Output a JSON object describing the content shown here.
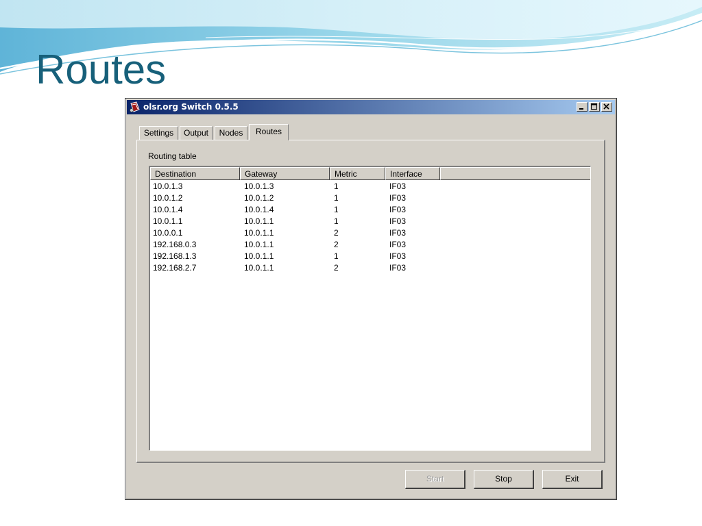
{
  "slide": {
    "title": "Routes"
  },
  "window": {
    "title": "olsr.org Switch 0.5.5",
    "controls": {
      "minimize_icon": "minimize-icon",
      "maximize_icon": "maximize-icon",
      "close_icon": "close-icon"
    }
  },
  "tabs": [
    {
      "label": "Settings",
      "active": false
    },
    {
      "label": "Output",
      "active": false
    },
    {
      "label": "Nodes",
      "active": false
    },
    {
      "label": "Routes",
      "active": true
    }
  ],
  "routing": {
    "group_label": "Routing table",
    "columns": [
      "Destination",
      "Gateway",
      "Metric",
      "Interface"
    ],
    "rows": [
      [
        "10.0.1.3",
        "10.0.1.3",
        "1",
        "IF03"
      ],
      [
        "10.0.1.2",
        "10.0.1.2",
        "1",
        "IF03"
      ],
      [
        "10.0.1.4",
        "10.0.1.4",
        "1",
        "IF03"
      ],
      [
        "10.0.1.1",
        "10.0.1.1",
        "1",
        "IF03"
      ],
      [
        "10.0.0.1",
        "10.0.1.1",
        "2",
        "IF03"
      ],
      [
        "192.168.0.3",
        "10.0.1.1",
        "2",
        "IF03"
      ],
      [
        "192.168.1.3",
        "10.0.1.1",
        "1",
        "IF03"
      ],
      [
        "192.168.2.7",
        "10.0.1.1",
        "2",
        "IF03"
      ]
    ]
  },
  "buttons": {
    "start": {
      "label": "Start",
      "enabled": false
    },
    "stop": {
      "label": "Stop",
      "enabled": true
    },
    "exit": {
      "label": "Exit",
      "enabled": true
    }
  },
  "colors": {
    "title_text": "#17607a",
    "titlebar_start": "#0a246a",
    "titlebar_end": "#a6caf0",
    "dialog_face": "#d4d0c8"
  }
}
